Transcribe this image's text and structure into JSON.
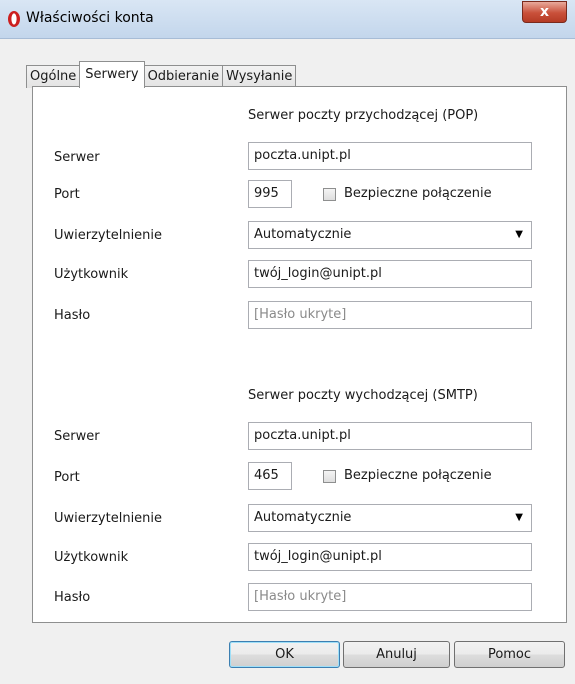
{
  "window": {
    "title": "Właściwości konta",
    "close_glyph": "x"
  },
  "tabs": [
    {
      "label": "Ogólne"
    },
    {
      "label": "Serwery"
    },
    {
      "label": "Odbieranie"
    },
    {
      "label": "Wysyłanie"
    }
  ],
  "incoming": {
    "heading": "Serwer poczty przychodzącej (POP)",
    "server_label": "Serwer",
    "server_value": "poczta.unipt.pl",
    "port_label": "Port",
    "port_value": "995",
    "secure_label": "Bezpieczne połączenie",
    "auth_label": "Uwierzytelnienie",
    "auth_value": "Automatycznie",
    "user_label": "Użytkownik",
    "user_value": "twój_login@unipt.pl",
    "password_label": "Hasło",
    "password_placeholder": "[Hasło ukryte]"
  },
  "outgoing": {
    "heading": "Serwer poczty wychodzącej (SMTP)",
    "server_label": "Serwer",
    "server_value": "poczta.unipt.pl",
    "port_label": "Port",
    "port_value": "465",
    "secure_label": "Bezpieczne połączenie",
    "auth_label": "Uwierzytelnienie",
    "auth_value": "Automatycznie",
    "user_label": "Użytkownik",
    "user_value": "twój_login@unipt.pl",
    "password_label": "Hasło",
    "password_placeholder": "[Hasło ukryte]"
  },
  "buttons": {
    "ok": "OK",
    "cancel": "Anuluj",
    "help": "Pomoc"
  },
  "icons": {
    "app": "opera-logo-icon",
    "dropdown": "chevron-down-icon",
    "close": "close-icon"
  },
  "colors": {
    "opera_red": "#cc1f1f",
    "title_bar": "#c9daee"
  }
}
